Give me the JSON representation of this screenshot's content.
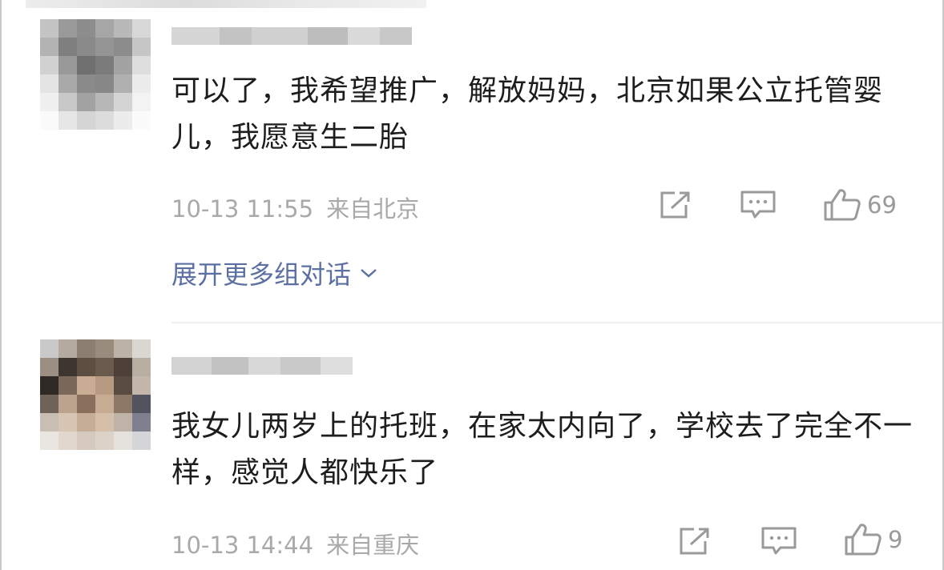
{
  "comments": [
    {
      "text": "可以了，我希望推广，解放妈妈，北京如果公立托管婴儿，我愿意生二胎",
      "date": "10-13 11:55",
      "location": "来自北京",
      "like_count": "69"
    },
    {
      "text": "我女儿两岁上的托班，在家太内向了，学校去了完全不一样，感觉人都快乐了",
      "date": "10-13 14:44",
      "location": "来自重庆",
      "like_count": "9"
    }
  ],
  "thread": {
    "expand_label": "展开更多组对话"
  },
  "icons": {
    "share": "share-icon",
    "reply": "comment-icon",
    "like": "thumbs-up-icon",
    "expand": "chevron-down-icon"
  },
  "colors": {
    "text": "#1d1d1d",
    "meta": "#a9a9a9",
    "link": "#5b6fa3",
    "icon": "#9a9a9a"
  }
}
